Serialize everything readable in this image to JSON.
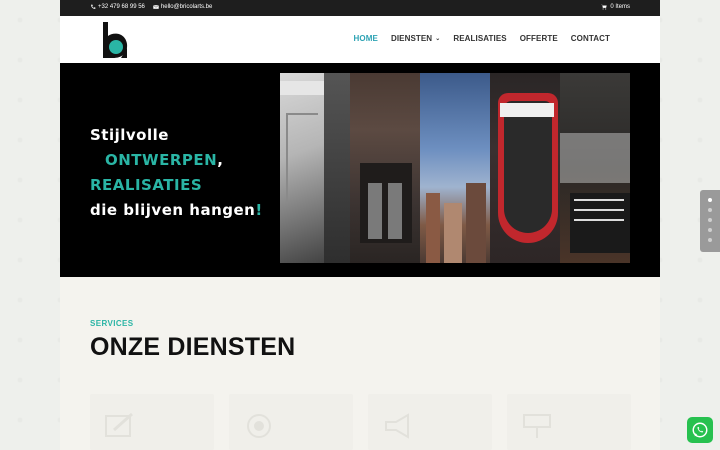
{
  "topbar": {
    "phone": "+32 479 68 99 56",
    "email": "hello@bricolarts.be",
    "cart": "0 Items"
  },
  "nav": {
    "items": [
      {
        "label": "HOME",
        "active": true
      },
      {
        "label": "DIENSTEN",
        "dropdown": true
      },
      {
        "label": "REALISATIES"
      },
      {
        "label": "OFFERTE"
      },
      {
        "label": "CONTACT"
      }
    ]
  },
  "hero": {
    "line1": "Stijlvolle",
    "line2_teal": "ONTWERPEN",
    "line2_tail": ",",
    "line3": "REALISATIES",
    "line4": "die blijven hangen",
    "line4_tail": "!"
  },
  "services": {
    "kicker": "SERVICES",
    "title": "ONZE DIENSTEN"
  },
  "colors": {
    "accent_teal": "#2ab5a5",
    "nav_active": "#2ea3b4",
    "whatsapp": "#27c14f"
  }
}
